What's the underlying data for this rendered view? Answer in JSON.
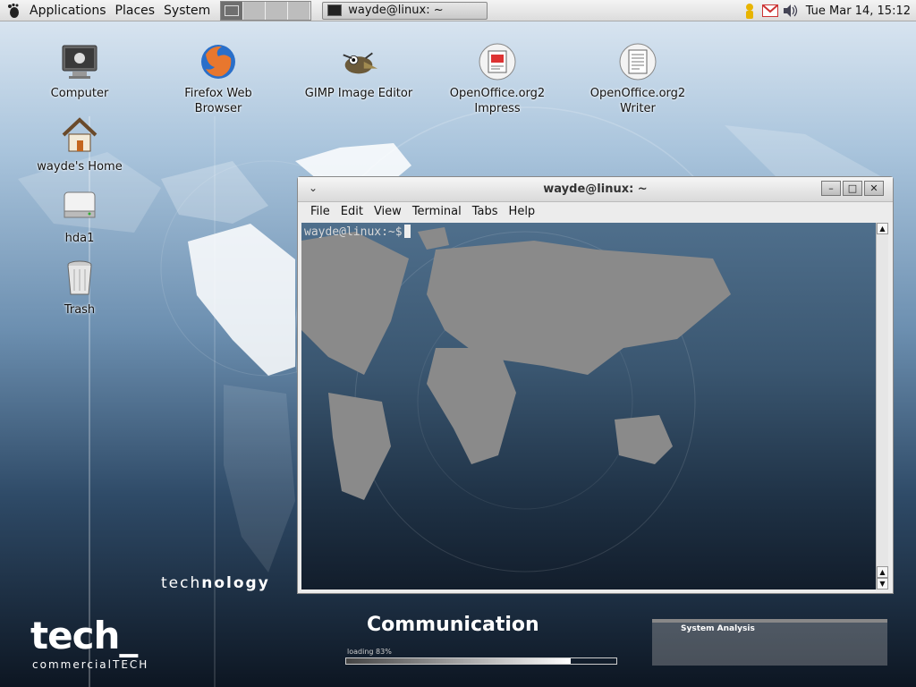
{
  "top_panel": {
    "menus": [
      "Applications",
      "Places",
      "System"
    ],
    "task": {
      "label": "wayde@linux: ~"
    },
    "clock": "Tue Mar 14, 15:12"
  },
  "desktop_icons": [
    {
      "label": "Computer",
      "icon": "computer-icon"
    },
    {
      "label": "Firefox Web Browser",
      "icon": "firefox-icon"
    },
    {
      "label": "GIMP Image Editor",
      "icon": "gimp-icon"
    },
    {
      "label": "OpenOffice.org2 Impress",
      "icon": "impress-icon"
    },
    {
      "label": "OpenOffice.org2 Writer",
      "icon": "writer-icon"
    },
    {
      "label": "wayde's Home",
      "icon": "home-icon"
    },
    {
      "label": "hda1",
      "icon": "drive-icon"
    },
    {
      "label": "Trash",
      "icon": "trash-icon"
    }
  ],
  "terminal": {
    "title": "wayde@linux: ~",
    "menus": [
      "File",
      "Edit",
      "View",
      "Terminal",
      "Tabs",
      "Help"
    ],
    "prompt": "wayde@linux:~$"
  },
  "wallpaper": {
    "technology_prefix": "tech",
    "technology_suffix": "nology",
    "logo": "tech_",
    "logo_sub": "commercialTECH",
    "communication": "Communication",
    "loading": "loading 83%",
    "loading_progress": 0.83,
    "system_analysis": "System Analysis"
  }
}
